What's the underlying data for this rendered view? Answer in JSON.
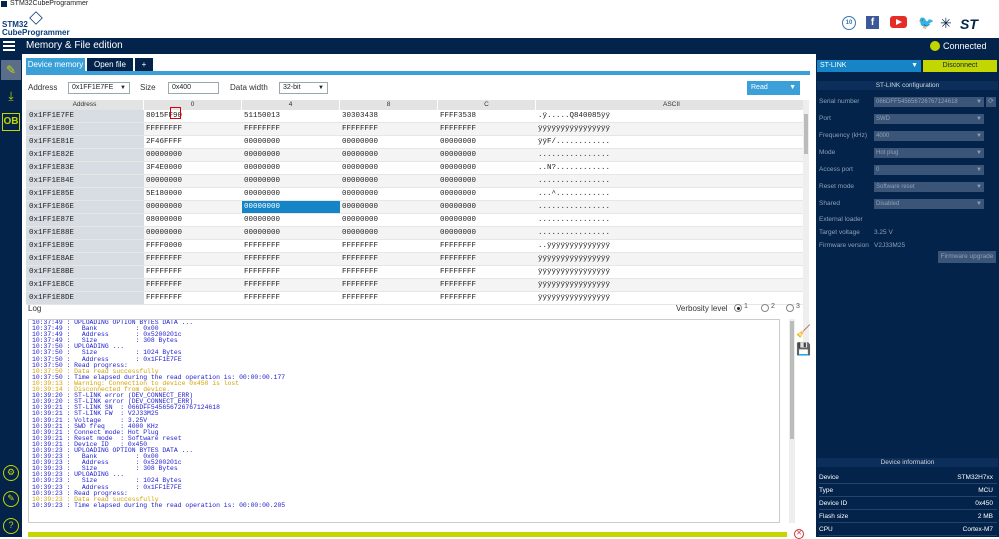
{
  "window": {
    "title": "STM32CubeProgrammer"
  },
  "brand": {
    "line1": "STM32",
    "line2": "CubeProgrammer",
    "badge": "10"
  },
  "topbar": {
    "title": "Memory & File edition",
    "status": "Connected"
  },
  "tabs": [
    {
      "label": "Device memory"
    },
    {
      "label": "Open file"
    },
    {
      "label": "+"
    }
  ],
  "controls": {
    "address_label": "Address",
    "address_value": "0x1FF1E7FE",
    "size_label": "Size",
    "size_value": "0x400",
    "width_label": "Data width",
    "width_value": "32-bit",
    "read_label": "Read"
  },
  "grid": {
    "headers": [
      "Address",
      "0",
      "4",
      "8",
      "C",
      "ASCII"
    ],
    "rows": [
      [
        "0x1FF1E7FE",
        "8015FF90",
        "51150013",
        "30303438",
        "FFFF3538",
        ".ÿ.....Q840085ÿÿ"
      ],
      [
        "0x1FF1E80E",
        "FFFFFFFF",
        "FFFFFFFF",
        "FFFFFFFF",
        "FFFFFFFF",
        "ÿÿÿÿÿÿÿÿÿÿÿÿÿÿÿÿ"
      ],
      [
        "0x1FF1E81E",
        "2F46FFFF",
        "00000000",
        "00000000",
        "00000000",
        "ÿÿF/............"
      ],
      [
        "0x1FF1E82E",
        "00000000",
        "00000000",
        "00000000",
        "00000000",
        "................"
      ],
      [
        "0x1FF1E83E",
        "3F4E0000",
        "00000000",
        "00000000",
        "00000000",
        "..N?............"
      ],
      [
        "0x1FF1E84E",
        "00000000",
        "00000000",
        "00000000",
        "00000000",
        "................"
      ],
      [
        "0x1FF1E85E",
        "5E180000",
        "00000000",
        "00000000",
        "00000000",
        "...^............"
      ],
      [
        "0x1FF1E86E",
        "00000000",
        "00000000",
        "00000000",
        "00000000",
        "................"
      ],
      [
        "0x1FF1E87E",
        "08000000",
        "00000000",
        "00000000",
        "00000000",
        "................"
      ],
      [
        "0x1FF1E88E",
        "00000000",
        "00000000",
        "00000000",
        "00000000",
        "................"
      ],
      [
        "0x1FF1E89E",
        "FFFF0000",
        "FFFFFFFF",
        "FFFFFFFF",
        "FFFFFFFF",
        "..ÿÿÿÿÿÿÿÿÿÿÿÿÿÿ"
      ],
      [
        "0x1FF1E8AE",
        "FFFFFFFF",
        "FFFFFFFF",
        "FFFFFFFF",
        "FFFFFFFF",
        "ÿÿÿÿÿÿÿÿÿÿÿÿÿÿÿÿ"
      ],
      [
        "0x1FF1E8BE",
        "FFFFFFFF",
        "FFFFFFFF",
        "FFFFFFFF",
        "FFFFFFFF",
        "ÿÿÿÿÿÿÿÿÿÿÿÿÿÿÿÿ"
      ],
      [
        "0x1FF1E8CE",
        "FFFFFFFF",
        "FFFFFFFF",
        "FFFFFFFF",
        "FFFFFFFF",
        "ÿÿÿÿÿÿÿÿÿÿÿÿÿÿÿÿ"
      ],
      [
        "0x1FF1E8DE",
        "FFFFFFFF",
        "FFFFFFFF",
        "FFFFFFFF",
        "FFFFFFFF",
        "ÿÿÿÿÿÿÿÿÿÿÿÿÿÿÿÿ"
      ]
    ]
  },
  "log": {
    "title": "Log",
    "verbosity_label": "Verbosity level",
    "levels": [
      "1",
      "2",
      "3"
    ],
    "lines": [
      {
        "t": "10:37:49 : UPLOADING OPTION BYTES DATA ...",
        "k": "n"
      },
      {
        "t": "10:37:49 :   Bank          : 0x00",
        "k": "n"
      },
      {
        "t": "10:37:49 :   Address       : 0x5200201c",
        "k": "n"
      },
      {
        "t": "10:37:49 :   Size          : 308 Bytes",
        "k": "n"
      },
      {
        "t": "10:37:50 : UPLOADING ...",
        "k": "n"
      },
      {
        "t": "10:37:50 :   Size          : 1024 Bytes",
        "k": "n"
      },
      {
        "t": "10:37:50 :   Address       : 0x1FF1E7FE",
        "k": "n"
      },
      {
        "t": "10:37:50 : Read progress:",
        "k": "n"
      },
      {
        "t": "10:37:50 : Data read successfully",
        "k": "ok"
      },
      {
        "t": "10:37:50 : Time elapsed during the read operation is: 00:00:00.177",
        "k": "n"
      },
      {
        "t": "10:39:13 : Warning: Connection to device 0x450 is lost",
        "k": "warn"
      },
      {
        "t": "10:39:14 : Disconnected from device.",
        "k": "warn"
      },
      {
        "t": "10:39:20 : ST-LINK error (DEV_CONNECT_ERR)",
        "k": "n"
      },
      {
        "t": "10:39:20 : ST-LINK error (DEV_CONNECT_ERR)",
        "k": "n"
      },
      {
        "t": "10:39:21 : ST-LINK SN  : 066DFF545656726767124618",
        "k": "n"
      },
      {
        "t": "10:39:21 : ST-LINK FW  : V2J33M25",
        "k": "n"
      },
      {
        "t": "10:39:21 : Voltage     : 3.25V",
        "k": "n"
      },
      {
        "t": "10:39:21 : SWD freq    : 4000 KHz",
        "k": "n"
      },
      {
        "t": "10:39:21 : Connect mode: Hot Plug",
        "k": "n"
      },
      {
        "t": "10:39:21 : Reset mode  : Software reset",
        "k": "n"
      },
      {
        "t": "10:39:21 : Device ID   : 0x450",
        "k": "n"
      },
      {
        "t": "10:39:23 : UPLOADING OPTION BYTES DATA ...",
        "k": "n"
      },
      {
        "t": "10:39:23 :   Bank          : 0x00",
        "k": "n"
      },
      {
        "t": "10:39:23 :   Address       : 0x5200201c",
        "k": "n"
      },
      {
        "t": "10:39:23 :   Size          : 308 Bytes",
        "k": "n"
      },
      {
        "t": "10:39:23 : UPLOADING ...",
        "k": "n"
      },
      {
        "t": "10:39:23 :   Size          : 1024 Bytes",
        "k": "n"
      },
      {
        "t": "10:39:23 :   Address       : 0x1FF1E7FE",
        "k": "n"
      },
      {
        "t": "10:39:23 : Read progress:",
        "k": "n"
      },
      {
        "t": "10:39:23 : Data read successfully",
        "k": "ok"
      },
      {
        "t": "10:39:23 : Time elapsed during the read operation is: 00:00:00.205",
        "k": "n"
      }
    ]
  },
  "right": {
    "interface": "ST-LINK",
    "disconnect_label": "Disconnect",
    "config_title": "ST-LINK configuration",
    "config": [
      {
        "label": "Serial number",
        "value": "066DFF545656726767124618",
        "type": "select"
      },
      {
        "label": "Port",
        "value": "SWD",
        "type": "select"
      },
      {
        "label": "Frequency (kHz)",
        "value": "4000",
        "type": "select"
      },
      {
        "label": "Mode",
        "value": "Hot plug",
        "type": "select"
      },
      {
        "label": "Access port",
        "value": "0",
        "type": "select"
      },
      {
        "label": "Reset mode",
        "value": "Software reset",
        "type": "select"
      },
      {
        "label": "Shared",
        "value": "Disabled",
        "type": "select"
      },
      {
        "label": "External loader",
        "value": "",
        "type": "text"
      },
      {
        "label": "Target voltage",
        "value": "3.25 V",
        "type": "text"
      },
      {
        "label": "Firmware version",
        "value": "V2J33M25",
        "type": "text"
      }
    ],
    "firmware_upgrade_label": "Firmware upgrade",
    "device_title": "Device information",
    "device": [
      {
        "label": "Device",
        "value": "STM32H7xx"
      },
      {
        "label": "Type",
        "value": "MCU"
      },
      {
        "label": "Device ID",
        "value": "0x450"
      },
      {
        "label": "Flash size",
        "value": "2 MB"
      },
      {
        "label": "CPU",
        "value": "Cortex-M7"
      }
    ]
  },
  "colors": {
    "navy": "#03234b",
    "accent": "#3ba0d8",
    "lime": "#c4d600",
    "selected": "#1585c7"
  }
}
